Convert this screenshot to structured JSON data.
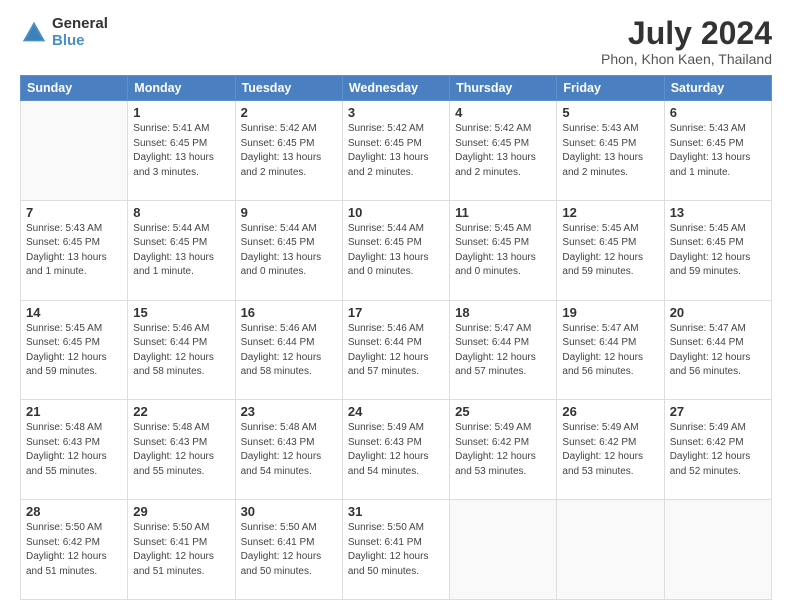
{
  "logo": {
    "general": "General",
    "blue": "Blue"
  },
  "title": "July 2024",
  "subtitle": "Phon, Khon Kaen, Thailand",
  "days_of_week": [
    "Sunday",
    "Monday",
    "Tuesday",
    "Wednesday",
    "Thursday",
    "Friday",
    "Saturday"
  ],
  "weeks": [
    [
      {
        "day": "",
        "info": ""
      },
      {
        "day": "1",
        "info": "Sunrise: 5:41 AM\nSunset: 6:45 PM\nDaylight: 13 hours\nand 3 minutes."
      },
      {
        "day": "2",
        "info": "Sunrise: 5:42 AM\nSunset: 6:45 PM\nDaylight: 13 hours\nand 2 minutes."
      },
      {
        "day": "3",
        "info": "Sunrise: 5:42 AM\nSunset: 6:45 PM\nDaylight: 13 hours\nand 2 minutes."
      },
      {
        "day": "4",
        "info": "Sunrise: 5:42 AM\nSunset: 6:45 PM\nDaylight: 13 hours\nand 2 minutes."
      },
      {
        "day": "5",
        "info": "Sunrise: 5:43 AM\nSunset: 6:45 PM\nDaylight: 13 hours\nand 2 minutes."
      },
      {
        "day": "6",
        "info": "Sunrise: 5:43 AM\nSunset: 6:45 PM\nDaylight: 13 hours\nand 1 minute."
      }
    ],
    [
      {
        "day": "7",
        "info": "Sunrise: 5:43 AM\nSunset: 6:45 PM\nDaylight: 13 hours\nand 1 minute."
      },
      {
        "day": "8",
        "info": "Sunrise: 5:44 AM\nSunset: 6:45 PM\nDaylight: 13 hours\nand 1 minute."
      },
      {
        "day": "9",
        "info": "Sunrise: 5:44 AM\nSunset: 6:45 PM\nDaylight: 13 hours\nand 0 minutes."
      },
      {
        "day": "10",
        "info": "Sunrise: 5:44 AM\nSunset: 6:45 PM\nDaylight: 13 hours\nand 0 minutes."
      },
      {
        "day": "11",
        "info": "Sunrise: 5:45 AM\nSunset: 6:45 PM\nDaylight: 13 hours\nand 0 minutes."
      },
      {
        "day": "12",
        "info": "Sunrise: 5:45 AM\nSunset: 6:45 PM\nDaylight: 12 hours\nand 59 minutes."
      },
      {
        "day": "13",
        "info": "Sunrise: 5:45 AM\nSunset: 6:45 PM\nDaylight: 12 hours\nand 59 minutes."
      }
    ],
    [
      {
        "day": "14",
        "info": "Sunrise: 5:45 AM\nSunset: 6:45 PM\nDaylight: 12 hours\nand 59 minutes."
      },
      {
        "day": "15",
        "info": "Sunrise: 5:46 AM\nSunset: 6:44 PM\nDaylight: 12 hours\nand 58 minutes."
      },
      {
        "day": "16",
        "info": "Sunrise: 5:46 AM\nSunset: 6:44 PM\nDaylight: 12 hours\nand 58 minutes."
      },
      {
        "day": "17",
        "info": "Sunrise: 5:46 AM\nSunset: 6:44 PM\nDaylight: 12 hours\nand 57 minutes."
      },
      {
        "day": "18",
        "info": "Sunrise: 5:47 AM\nSunset: 6:44 PM\nDaylight: 12 hours\nand 57 minutes."
      },
      {
        "day": "19",
        "info": "Sunrise: 5:47 AM\nSunset: 6:44 PM\nDaylight: 12 hours\nand 56 minutes."
      },
      {
        "day": "20",
        "info": "Sunrise: 5:47 AM\nSunset: 6:44 PM\nDaylight: 12 hours\nand 56 minutes."
      }
    ],
    [
      {
        "day": "21",
        "info": "Sunrise: 5:48 AM\nSunset: 6:43 PM\nDaylight: 12 hours\nand 55 minutes."
      },
      {
        "day": "22",
        "info": "Sunrise: 5:48 AM\nSunset: 6:43 PM\nDaylight: 12 hours\nand 55 minutes."
      },
      {
        "day": "23",
        "info": "Sunrise: 5:48 AM\nSunset: 6:43 PM\nDaylight: 12 hours\nand 54 minutes."
      },
      {
        "day": "24",
        "info": "Sunrise: 5:49 AM\nSunset: 6:43 PM\nDaylight: 12 hours\nand 54 minutes."
      },
      {
        "day": "25",
        "info": "Sunrise: 5:49 AM\nSunset: 6:42 PM\nDaylight: 12 hours\nand 53 minutes."
      },
      {
        "day": "26",
        "info": "Sunrise: 5:49 AM\nSunset: 6:42 PM\nDaylight: 12 hours\nand 53 minutes."
      },
      {
        "day": "27",
        "info": "Sunrise: 5:49 AM\nSunset: 6:42 PM\nDaylight: 12 hours\nand 52 minutes."
      }
    ],
    [
      {
        "day": "28",
        "info": "Sunrise: 5:50 AM\nSunset: 6:42 PM\nDaylight: 12 hours\nand 51 minutes."
      },
      {
        "day": "29",
        "info": "Sunrise: 5:50 AM\nSunset: 6:41 PM\nDaylight: 12 hours\nand 51 minutes."
      },
      {
        "day": "30",
        "info": "Sunrise: 5:50 AM\nSunset: 6:41 PM\nDaylight: 12 hours\nand 50 minutes."
      },
      {
        "day": "31",
        "info": "Sunrise: 5:50 AM\nSunset: 6:41 PM\nDaylight: 12 hours\nand 50 minutes."
      },
      {
        "day": "",
        "info": ""
      },
      {
        "day": "",
        "info": ""
      },
      {
        "day": "",
        "info": ""
      }
    ]
  ]
}
